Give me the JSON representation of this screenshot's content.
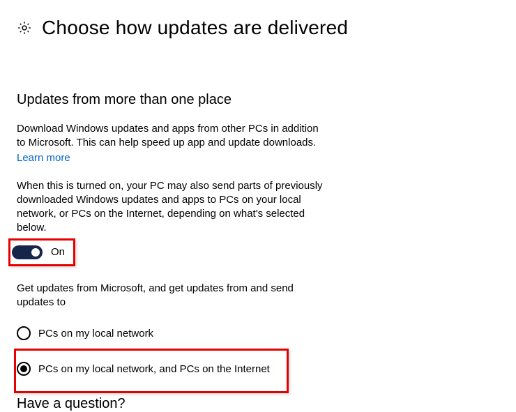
{
  "header": {
    "title": "Choose how updates are delivered"
  },
  "section": {
    "title": "Updates from more than one place",
    "desc1": "Download Windows updates and apps from other PCs in addition to Microsoft. This can help speed up app and update downloads.",
    "learn_more": "Learn more",
    "desc2": "When this is turned on, your PC may also send parts of previously downloaded Windows updates and apps to PCs on your local network, or PCs on the Internet, depending on what's selected below.",
    "toggle_label": "On",
    "desc3": "Get updates from Microsoft, and get updates from and send updates to",
    "radio1": "PCs on my local network",
    "radio2": "PCs on my local network, and PCs on the Internet"
  },
  "footer": {
    "question": "Have a question?"
  }
}
